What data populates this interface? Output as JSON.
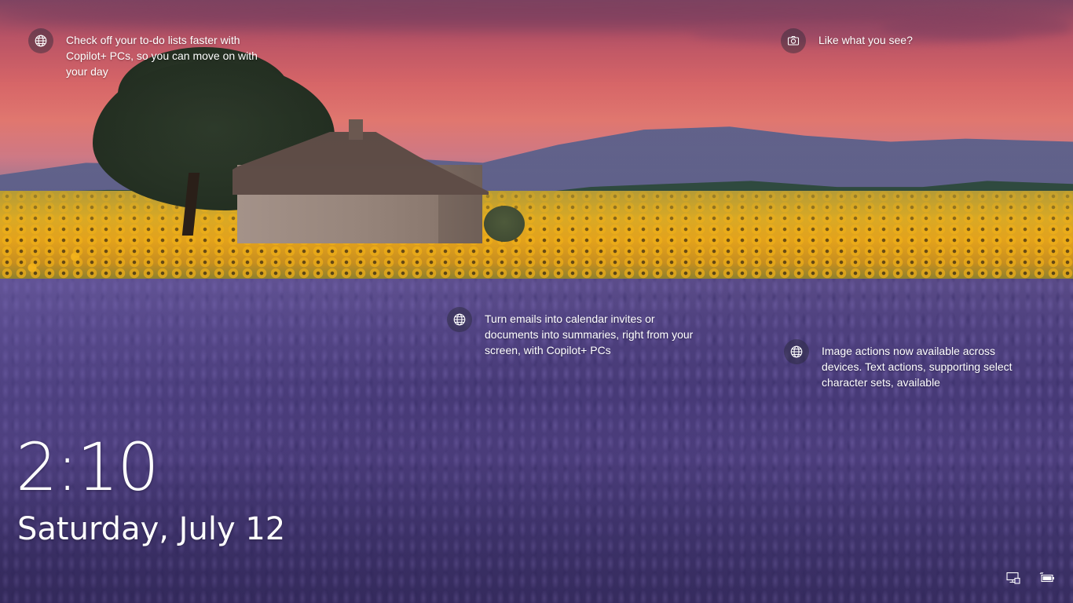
{
  "lockscreen": {
    "hotspots": [
      {
        "icon": "globe-icon",
        "text": "Check off your to-do lists faster with Copilot+ PCs, so you can move on with your day"
      },
      {
        "icon": "camera-icon",
        "text": "Like what you see?"
      },
      {
        "icon": "globe-icon",
        "text": "Turn emails into calendar invites or documents into summaries, right from your screen, with Copilot+ PCs"
      },
      {
        "icon": "globe-icon",
        "text": "Image actions now available across devices. Text actions, supporting select character sets, available"
      }
    ],
    "time": "2:10",
    "date": "Saturday, July 12",
    "status_icons": [
      "network-icon",
      "battery-icon"
    ]
  },
  "colors": {
    "text": "#ffffff",
    "icon_bg": "#28283773",
    "sky_top": "#8a4a6a",
    "sky_mid": "#e06a6c",
    "sunflower": "#e3a21c",
    "lavender": "#514384"
  }
}
